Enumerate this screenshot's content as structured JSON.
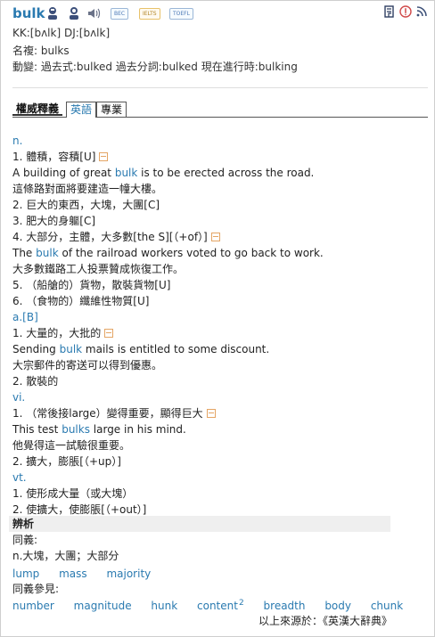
{
  "entry": {
    "headword": "bulk",
    "badges": [
      "BEC",
      "IELTS",
      "TOEFL"
    ],
    "pronunciation": "KK:[bʌlk]  DJ:[bʌlk]",
    "plural": "名複: bulks",
    "verb_forms": "動變: 過去式:bulked  過去分詞:bulked  現在進行時:bulking"
  },
  "tabs": [
    "權威釋義",
    "英語",
    "專業"
  ],
  "definition_lines": [
    {
      "kind": "pos",
      "text": "n."
    },
    {
      "kind": "text",
      "text": "1. 體積，容積[U]",
      "expand": true
    },
    {
      "kind": "example",
      "before": "A building of great ",
      "highlight": "bulk",
      "after": " is to be erected across the road."
    },
    {
      "kind": "text",
      "text": "這條路對面將要建造一幢大樓。"
    },
    {
      "kind": "text",
      "text": "2. 巨大的東西，大塊，大團[C]"
    },
    {
      "kind": "text",
      "text": "3. 肥大的身軀[C]"
    },
    {
      "kind": "text",
      "text": "4. 大部分，主體，大多數[the S][（+of）]",
      "expand": true
    },
    {
      "kind": "example",
      "before": "The ",
      "highlight": "bulk",
      "after": " of the railroad workers voted to go back to work."
    },
    {
      "kind": "text",
      "text": "大多數鐵路工人投票贊成恢復工作。"
    },
    {
      "kind": "text",
      "text": "5. （船艙的）貨物，散裝貨物[U]"
    },
    {
      "kind": "text",
      "text": "6. （食物的）纖維性物質[U]"
    },
    {
      "kind": "pos",
      "text": "a.[B]"
    },
    {
      "kind": "text",
      "text": "1. 大量的，大批的",
      "expand": true
    },
    {
      "kind": "example",
      "before": "Sending ",
      "highlight": "bulk",
      "after": " mails is entitled to some discount."
    },
    {
      "kind": "text",
      "text": "大宗郵件的寄送可以得到優惠。"
    },
    {
      "kind": "text",
      "text": "2. 散裝的"
    },
    {
      "kind": "pos",
      "text": "vi."
    },
    {
      "kind": "text",
      "text": "1. （常後接large）變得重要，顯得巨大",
      "expand": true
    },
    {
      "kind": "example",
      "before": "This test ",
      "highlight": "bulks",
      "after": " large in his mind."
    },
    {
      "kind": "text",
      "text": "他覺得這一試驗很重要。"
    },
    {
      "kind": "text",
      "text": "2. 擴大，膨脹[（+up）]"
    },
    {
      "kind": "pos",
      "text": "vt."
    },
    {
      "kind": "text",
      "text": "1. 使形成大量（或大塊）"
    },
    {
      "kind": "text",
      "text": "2. 使擴大，使膨脹[（+out）]"
    }
  ],
  "analysis": {
    "title": "辨析",
    "synonyms_label": "同義:",
    "synonym_gloss": "n.大塊，大團；大部分",
    "synonyms": [
      "lump",
      "mass",
      "majority"
    ],
    "see_also_label": "同義參見:",
    "see_also": [
      {
        "word": "number"
      },
      {
        "word": "magnitude"
      },
      {
        "word": "hunk"
      },
      {
        "word": "content",
        "sup": "2"
      },
      {
        "word": "breadth"
      },
      {
        "word": "body"
      },
      {
        "word": "chunk"
      }
    ],
    "source": "以上來源於：《英漢大辭典》"
  },
  "icons": {
    "pron_uk": "speaker-person-uk-icon",
    "pron_us": "speaker-person-us-icon",
    "speaker": "speaker-icon",
    "wordbook": "wordbook-icon",
    "info": "info-icon",
    "rss": "rss-icon"
  }
}
